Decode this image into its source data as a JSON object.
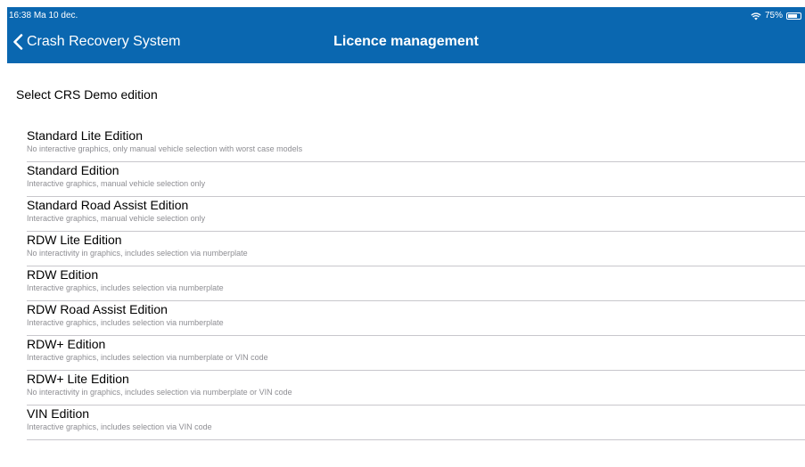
{
  "status_bar": {
    "time": "16:38",
    "date": "Ma 10 dec.",
    "battery": "75%",
    "battery_level": 0.75
  },
  "nav": {
    "back_label": "Crash Recovery System",
    "title": "Licence management",
    "bar_color": "#0a67b0"
  },
  "section_title": "Select CRS Demo edition",
  "editions": [
    {
      "title": "Standard Lite Edition",
      "subtitle": "No interactive graphics, only manual vehicle selection with worst case models"
    },
    {
      "title": "Standard Edition",
      "subtitle": "Interactive graphics, manual vehicle selection only"
    },
    {
      "title": "Standard Road Assist Edition",
      "subtitle": "Interactive graphics, manual vehicle selection only"
    },
    {
      "title": "RDW Lite Edition",
      "subtitle": "No interactivity in graphics, includes selection via numberplate"
    },
    {
      "title": "RDW Edition",
      "subtitle": "Interactive graphics, includes selection via numberplate"
    },
    {
      "title": "RDW Road Assist Edition",
      "subtitle": "Interactive graphics, includes selection via numberplate"
    },
    {
      "title": "RDW+ Edition",
      "subtitle": "Interactive graphics, includes selection via numberplate or VIN code"
    },
    {
      "title": "RDW+ Lite Edition",
      "subtitle": "No interactivity in graphics, includes selection via numberplate or VIN code"
    },
    {
      "title": "VIN Edition",
      "subtitle": "Interactive graphics, includes selection via VIN code"
    }
  ]
}
